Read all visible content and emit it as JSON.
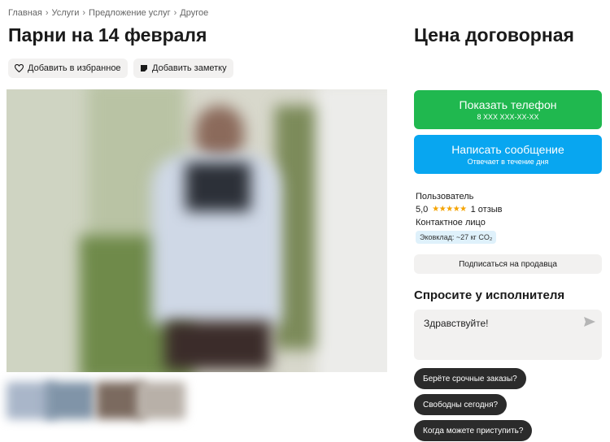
{
  "breadcrumbs": [
    "Главная",
    "Услуги",
    "Предложение услуг",
    "Другое"
  ],
  "listing": {
    "title": "Парни на 14 февраля",
    "price": "Цена договорная",
    "favorite_label": "Добавить в избранное",
    "note_label": "Добавить заметку"
  },
  "contact": {
    "show_phone_label": "Показать телефон",
    "phone_masked": "8 XXX XXX-XX-XX",
    "message_label": "Написать сообщение",
    "response_note": "Отвечает в течение дня"
  },
  "seller": {
    "name": "Пользователь",
    "rating": "5,0",
    "stars": 5,
    "reviews": "1 отзыв",
    "role": "Контактное лицо",
    "eco_badge": "Эковклад: ~27 кг CO₂",
    "subscribe_label": "Подписаться на продавца"
  },
  "ask": {
    "title": "Спросите у исполнителя",
    "message_value": "Здравствуйте!",
    "suggestions": [
      "Берёте срочные заказы?",
      "Свободны сегодня?",
      "Когда можете приступить?"
    ]
  },
  "colors": {
    "green": "#20b84f",
    "blue": "#08a6f0",
    "star": "#f5a300"
  },
  "icons": [
    "chevron-right-icon",
    "heart-icon",
    "note-icon",
    "star-icon",
    "send-icon"
  ]
}
